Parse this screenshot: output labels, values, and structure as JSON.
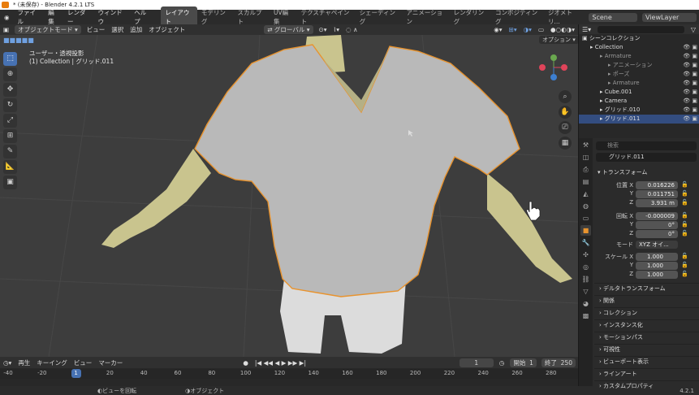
{
  "window": {
    "title": "* (未保存) - Blender 4.2.1 LTS"
  },
  "topbar": {
    "menus": [
      "ファイル",
      "編集",
      "レンダー",
      "ウィンドウ",
      "ヘルプ"
    ],
    "workspaces": [
      "レイアウト",
      "モデリング",
      "スカルプト",
      "UV編集",
      "テクスチャペイント",
      "シェーディング",
      "アニメーション",
      "レンダリング",
      "コンポジティング",
      "ジオメトリ…"
    ],
    "scene": "Scene",
    "viewlayer": "ViewLayer"
  },
  "viewport_header": {
    "mode": "オブジェクトモード",
    "menus": [
      "ビュー",
      "選択",
      "追加",
      "オブジェクト"
    ],
    "orientation": "グローバル",
    "options": "オプション"
  },
  "viewport": {
    "info_line1": "ユーザー・透視投影",
    "info_line2": "(1) Collection | グリッド.011"
  },
  "timeline": {
    "menus": [
      "再生",
      "キーイング",
      "ビュー",
      "マーカー"
    ],
    "current_frame": "1",
    "start_label": "開始",
    "start": "1",
    "end_label": "終了",
    "end": "250",
    "ruler": [
      "-40",
      "-20",
      "1",
      "20",
      "40",
      "60",
      "80",
      "100",
      "120",
      "140",
      "160",
      "180",
      "200",
      "220",
      "240",
      "260",
      "280"
    ]
  },
  "status": {
    "left": "ビューを回転",
    "right": "オブジェクト",
    "version": "4.2.1"
  },
  "outliner": {
    "header_title": "シーンコレクション",
    "rows": [
      {
        "label": "Collection",
        "dim": false,
        "sel": false
      },
      {
        "label": "Armature",
        "dim": true,
        "sel": false
      },
      {
        "label": "アニメーション",
        "dim": true,
        "sel": false
      },
      {
        "label": "ポーズ",
        "dim": true,
        "sel": false
      },
      {
        "label": "Armature",
        "dim": true,
        "sel": false
      },
      {
        "label": "Cube.001",
        "dim": false,
        "sel": false
      },
      {
        "label": "Camera",
        "dim": false,
        "sel": false
      },
      {
        "label": "グリッド.010",
        "dim": false,
        "sel": false
      },
      {
        "label": "グリッド.011",
        "dim": false,
        "sel": true
      }
    ]
  },
  "properties": {
    "search_placeholder": "検索",
    "object_name": "グリッド.011",
    "transform_title": "トランスフォーム",
    "location_label": "位置 X",
    "loc_x": "0.016226",
    "loc_y": "0.011751",
    "loc_z": "3.931 m",
    "rotation_label": "回転 X",
    "rot_x": "-0.000009",
    "rot_y": "0°",
    "rot_z": "0°",
    "mode_label": "モード",
    "mode_value": "XYZ オイ...",
    "scale_label": "スケール X",
    "scale_x": "1.000",
    "scale_y": "1.000",
    "scale_z": "1.000",
    "y_label": "Y",
    "z_label": "Z",
    "sections": [
      "デルタトランスフォーム",
      "関係",
      "コレクション",
      "インスタンス化",
      "モーションパス",
      "可視性",
      "ビューポート表示",
      "ラインアート",
      "カスタムプロパティ"
    ]
  },
  "colors": {
    "accent": "#4772b3",
    "select_outline": "#e8932e",
    "background": "#3d3d3d"
  }
}
